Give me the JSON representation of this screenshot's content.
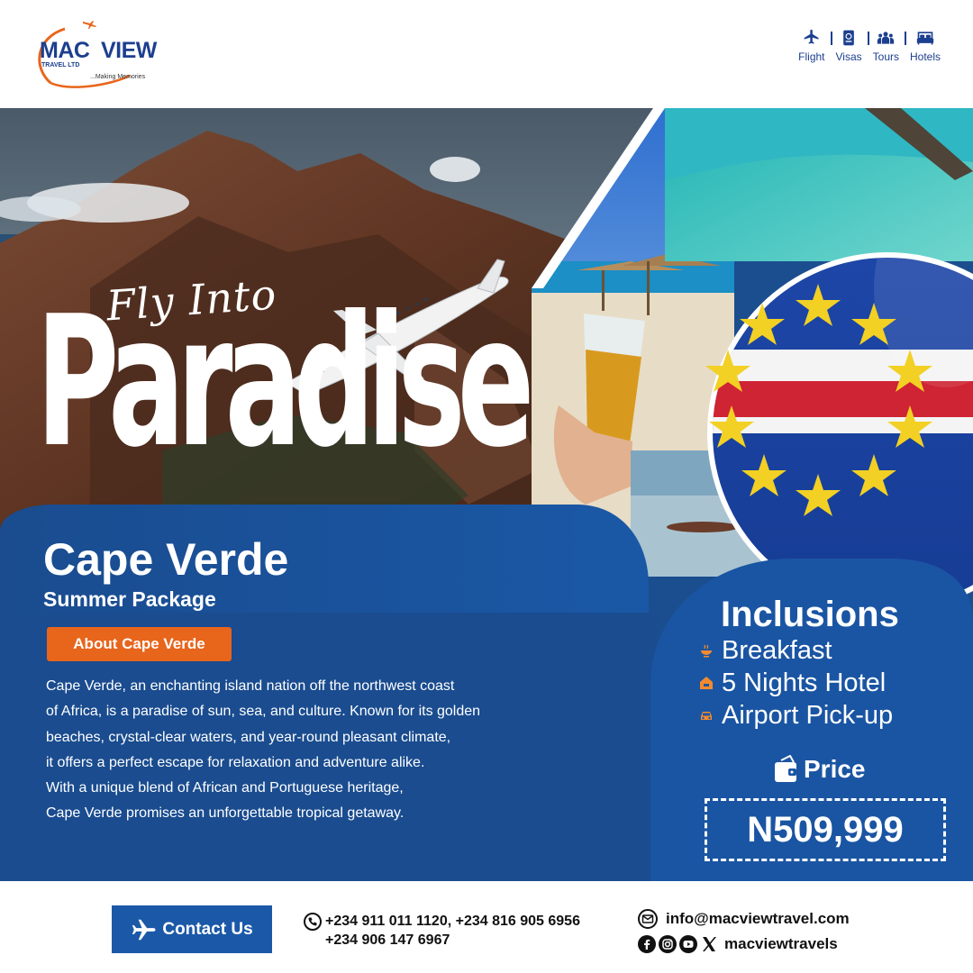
{
  "brand": {
    "name_part1": "MAC",
    "name_part2": "VIEW",
    "subtitle": "TRAVEL LTD",
    "tagline": "...Making Memories",
    "primary_color": "#1c3f8f",
    "accent_color": "#e8651c"
  },
  "nav": [
    {
      "label": "Flight",
      "icon": "airplane-icon"
    },
    {
      "label": "Visas",
      "icon": "passport-icon"
    },
    {
      "label": "Tours",
      "icon": "group-icon"
    },
    {
      "label": "Hotels",
      "icon": "bed-icon"
    }
  ],
  "hero": {
    "headline_small": "Fly Into",
    "headline_large": "Paradise"
  },
  "destination": {
    "title": "Cape Verde",
    "subtitle": "Summer Package",
    "about_label": "About Cape Verde",
    "about_lines": [
      "Cape Verde, an enchanting island nation off the northwest coast",
      "of Africa, is a paradise of sun, sea, and culture. Known for its golden",
      "beaches, crystal-clear waters, and year-round pleasant climate,",
      "it offers a perfect escape for relaxation and adventure alike.",
      "With a unique blend of African and Portuguese heritage,",
      "Cape Verde promises an unforgettable tropical getaway."
    ]
  },
  "inclusions": {
    "title": "Inclusions",
    "items": [
      {
        "label": "Breakfast",
        "icon": "food-bowl-icon"
      },
      {
        "label": "5 Nights Hotel",
        "icon": "hotel-icon"
      },
      {
        "label": "Airport Pick-up",
        "icon": "car-icon"
      }
    ]
  },
  "price": {
    "label": "Price",
    "value": "N509,999"
  },
  "footer": {
    "contact_button": "Contact Us",
    "phone_line1": "+234 911 011 1120, +234 816 905 6956",
    "phone_line2": "+234 906 147 6967",
    "email": "info@macviewtravel.com",
    "social_handle": "macviewtravels",
    "social_icons": [
      "facebook-icon",
      "instagram-icon",
      "youtube-icon",
      "x-icon"
    ]
  }
}
